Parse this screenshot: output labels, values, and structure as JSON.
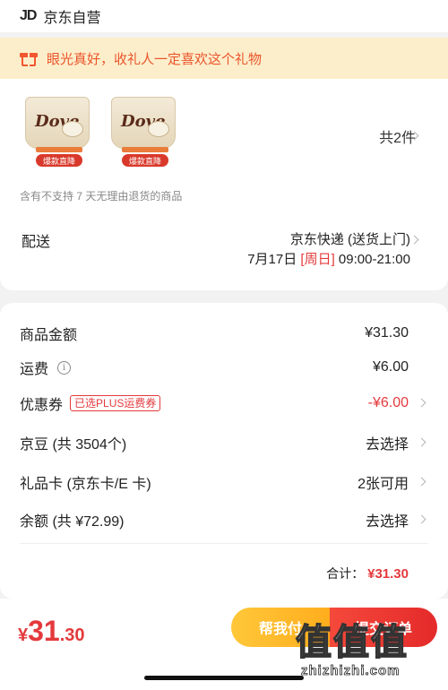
{
  "store": {
    "brand": "JD",
    "name": "京东自营"
  },
  "gift_banner": {
    "text": "眼光真好，收礼人一定喜欢这个礼物",
    "icon": "gift-icon"
  },
  "goods": {
    "products": [
      {
        "brand": "Dove",
        "tag": "爆款直降"
      },
      {
        "brand": "Dove",
        "tag": "爆款直降"
      }
    ],
    "count_text": "共2件",
    "notice": "含有不支持 7 天无理由退货的商品"
  },
  "delivery": {
    "label": "配送",
    "method": "京东快递 (送货上门)",
    "date": "7月17日",
    "weekday": "[周日]",
    "time": "09:00-21:00"
  },
  "summary": {
    "rows": [
      {
        "label": "商品金额",
        "value": "¥31.30"
      },
      {
        "label": "运费",
        "value": "¥6.00"
      },
      {
        "label": "优惠券",
        "badge": "已选PLUS运费券",
        "value": "-¥6.00"
      },
      {
        "label": "京豆 (共 3504个)",
        "value": "去选择"
      },
      {
        "label": "礼品卡 (京东卡/E 卡)",
        "value": "2张可用"
      },
      {
        "label": "余额 (共 ¥72.99)",
        "value": "去选择"
      }
    ],
    "total_label": "合计：",
    "total_amount": "¥31.30"
  },
  "bottom": {
    "price_symbol": "¥",
    "price_int": "31",
    "price_dec": ".30",
    "help_pay_label": "帮我付",
    "submit_label": "提交订单"
  },
  "watermark": {
    "text": "值值值",
    "site": "zhizhizhi.com"
  },
  "colors": {
    "accent": "#e4393c",
    "banner_bg": "#fdeecb",
    "help_btn": "#ffb71f"
  }
}
